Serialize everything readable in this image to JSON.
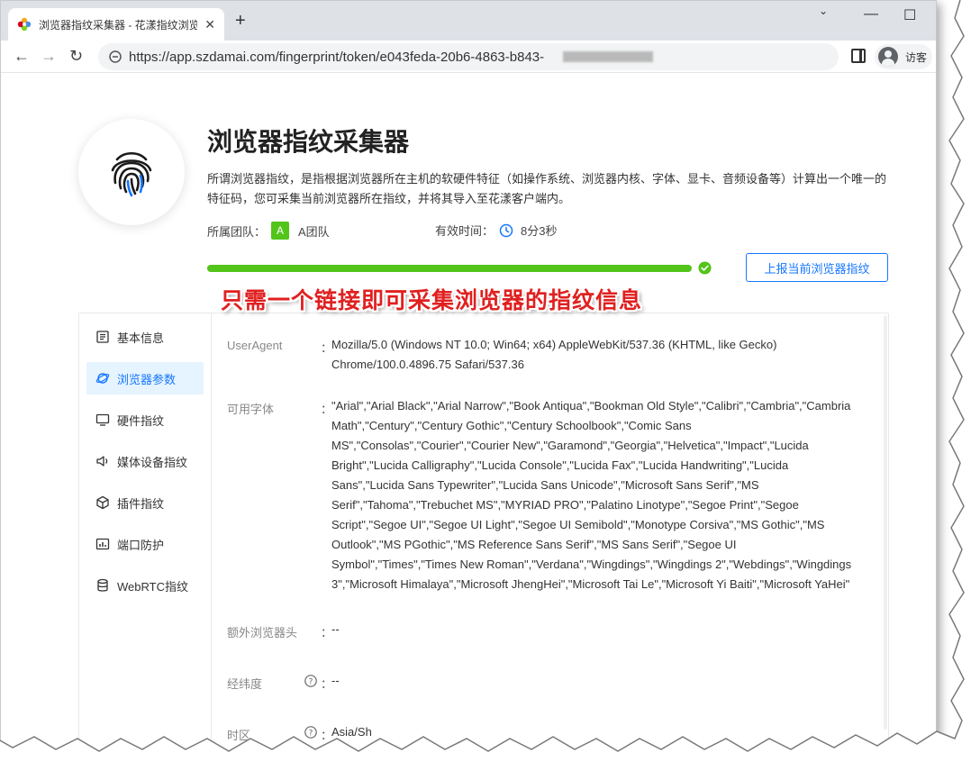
{
  "browser": {
    "tab_title": "浏览器指纹采集器 - 花漾指纹浏览",
    "tab_close": "✕",
    "new_tab": "+",
    "url": "https://app.szdamai.com/fingerprint/token/e043feda-20b6-4863-b843-",
    "profile_label": "访客",
    "win_min": "⌄",
    "win_minimize": "—",
    "win_maximize": "☐",
    "win_close": "✕"
  },
  "header": {
    "title": "浏览器指纹采集器",
    "description": "所谓浏览器指纹，是指根据浏览器所在主机的软硬件特征（如操作系统、浏览器内核、字体、显卡、音频设备等）计算出一个唯一的特征码，您可采集当前浏览器所在指纹，并将其导入至花漾客户端内。",
    "team_label": "所属团队：",
    "team_badge": "A",
    "team_name": "A团队",
    "validity_label": "有效时间：",
    "validity_value": "8分3秒",
    "progress_percent": 100,
    "report_button": "上报当前浏览器指纹"
  },
  "overlay_caption": "只需一个链接即可采集浏览器的指纹信息",
  "menu": [
    {
      "label": "基本信息",
      "icon": "list-icon"
    },
    {
      "label": "浏览器参数",
      "icon": "planet-icon",
      "active": true
    },
    {
      "label": "硬件指纹",
      "icon": "monitor-icon"
    },
    {
      "label": "媒体设备指纹",
      "icon": "speaker-icon"
    },
    {
      "label": "插件指纹",
      "icon": "cube-icon"
    },
    {
      "label": "端口防护",
      "icon": "bar-chart-icon"
    },
    {
      "label": "WebRTC指纹",
      "icon": "database-icon"
    }
  ],
  "fields": {
    "user_agent": {
      "label": "UserAgent",
      "colon": "：",
      "value": "Mozilla/5.0 (Windows NT 10.0; Win64; x64) AppleWebKit/537.36 (KHTML, like Gecko) Chrome/100.0.4896.75 Safari/537.36"
    },
    "fonts": {
      "label": "可用字体",
      "colon": "：",
      "value": "\"Arial\",\"Arial Black\",\"Arial Narrow\",\"Book Antiqua\",\"Bookman Old Style\",\"Calibri\",\"Cambria\",\"Cambria Math\",\"Century\",\"Century Gothic\",\"Century Schoolbook\",\"Comic Sans MS\",\"Consolas\",\"Courier\",\"Courier New\",\"Garamond\",\"Georgia\",\"Helvetica\",\"Impact\",\"Lucida Bright\",\"Lucida Calligraphy\",\"Lucida Console\",\"Lucida Fax\",\"Lucida Handwriting\",\"Lucida Sans\",\"Lucida Sans Typewriter\",\"Lucida Sans Unicode\",\"Microsoft Sans Serif\",\"MS Serif\",\"Tahoma\",\"Trebuchet MS\",\"MYRIAD PRO\",\"Palatino Linotype\",\"Segoe Print\",\"Segoe Script\",\"Segoe UI\",\"Segoe UI Light\",\"Segoe UI Semibold\",\"Monotype Corsiva\",\"MS Gothic\",\"MS Outlook\",\"MS PGothic\",\"MS Reference Sans Serif\",\"MS Sans Serif\",\"Segoe UI Symbol\",\"Times\",\"Times New Roman\",\"Verdana\",\"Wingdings\",\"Wingdings 2\",\"Webdings\",\"Wingdings 3\",\"Microsoft Himalaya\",\"Microsoft JhengHei\",\"Microsoft Tai Le\",\"Microsoft Yi Baiti\",\"Microsoft YaHei\""
    },
    "extra_headers": {
      "label": "额外浏览器头",
      "colon": "：",
      "value": "--"
    },
    "geo": {
      "label": "经纬度",
      "colon": "：",
      "value": "--"
    },
    "timezone": {
      "label": "时区",
      "colon": "：",
      "value": "Asia/Sh"
    }
  },
  "colors": {
    "accent": "#1677ff",
    "success": "#52c41a",
    "caption": "#e02020"
  }
}
